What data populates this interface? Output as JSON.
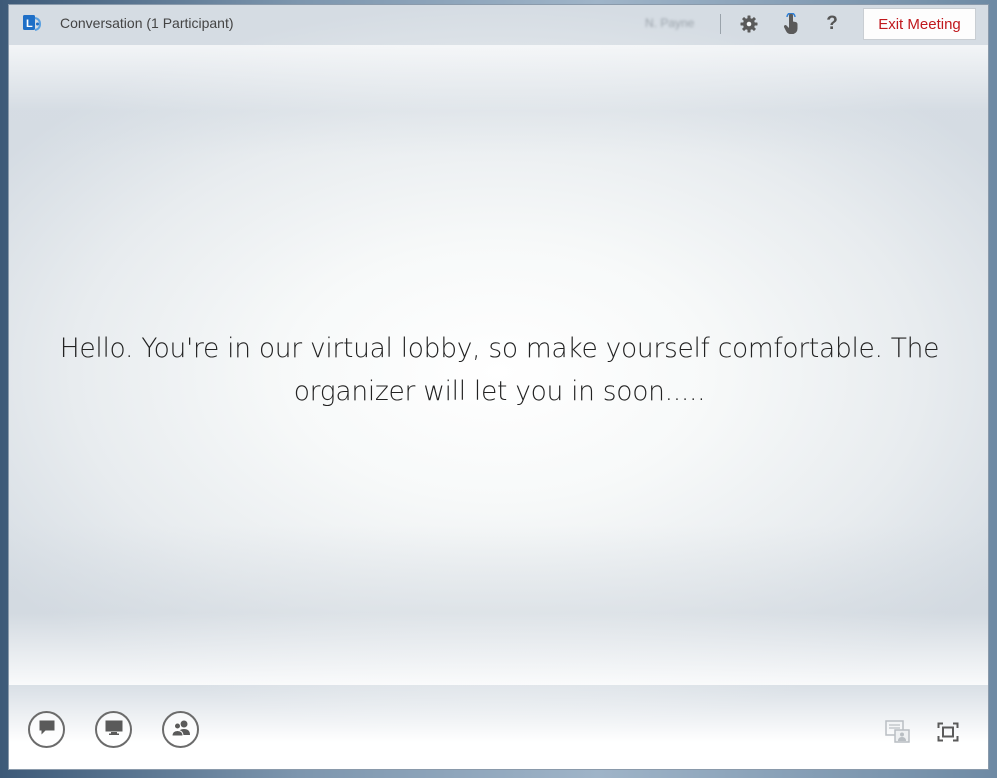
{
  "window": {
    "title": "Conversation (1 Participant)",
    "user_name": "N. Payne",
    "exit_label": "Exit Meeting"
  },
  "icons": {
    "app": "lync-logo-icon",
    "settings": "gear-icon",
    "touch": "touch-hand-icon",
    "help": "question-mark-icon",
    "chat": "chat-bubble-icon",
    "present": "monitor-icon",
    "participants": "people-icon",
    "content_view": "content-view-icon",
    "fullscreen": "fullscreen-icon"
  },
  "toolbar": {
    "help_glyph": "?"
  },
  "lobby": {
    "line1": "Hello. You're in our virtual lobby, so make yourself comfortable. The",
    "line2": "organizer will let you in soon....."
  },
  "colors": {
    "accent": "#c0181d",
    "logo_blue": "#1e6fc7",
    "icon_gray": "#5a5a5a"
  }
}
